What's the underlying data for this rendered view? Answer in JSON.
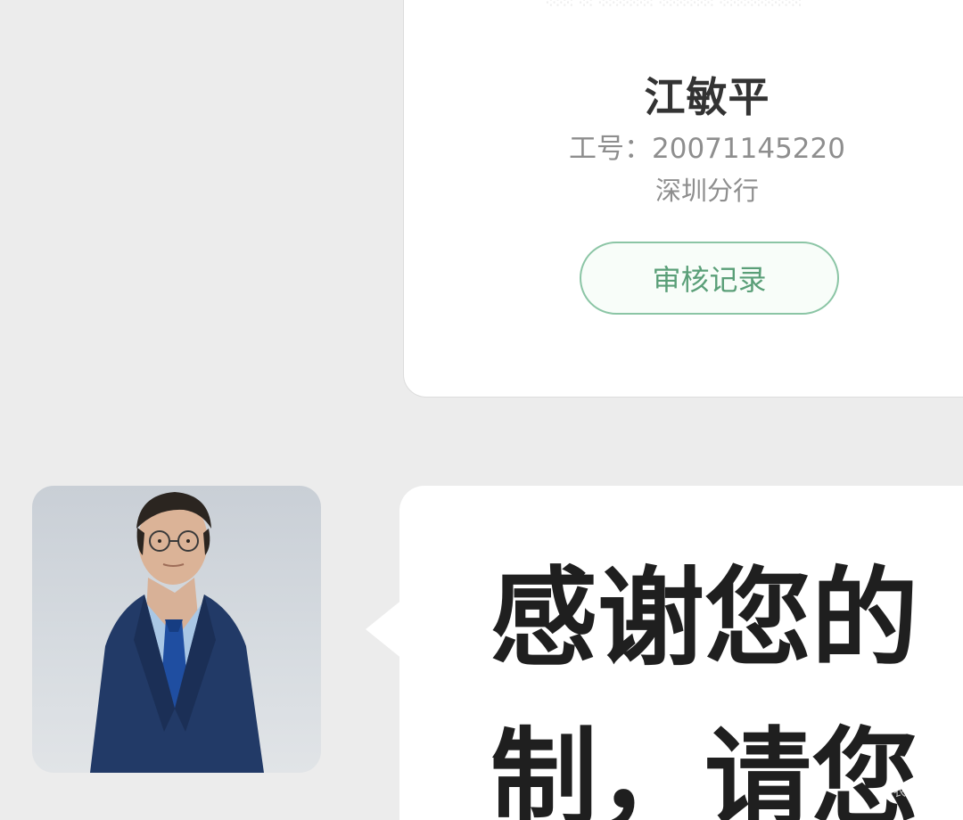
{
  "profile": {
    "name": "江敏平",
    "employee_id": "工号：20071145220",
    "branch": "深圳分行",
    "audit_button_label": "审核记录"
  },
  "chat": {
    "line1": "感谢您的",
    "line2": "制，请您"
  },
  "watermark": "卡农社区"
}
